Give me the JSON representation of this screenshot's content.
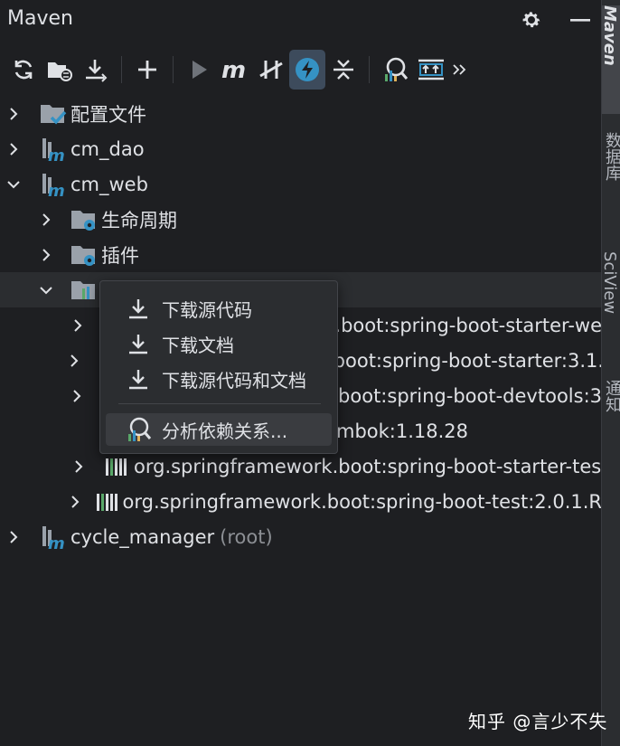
{
  "window": {
    "title": "Maven"
  },
  "title_actions": [
    {
      "name": "settings-gear-icon"
    },
    {
      "name": "minimize-icon"
    }
  ],
  "toolbar": {
    "buttons": [
      "reload-icon",
      "generate-sources-icon",
      "download-icon",
      "add-icon",
      "run-icon",
      "execute-maven-goal-icon",
      "toggle-offline-icon",
      "skip-tests-icon",
      "collapse-all-icon",
      "analyze-dependencies-icon",
      "show-dependencies-icon",
      "more-icon"
    ]
  },
  "tree": {
    "rows": [
      {
        "label": "配置文件"
      },
      {
        "label": "cm_dao"
      },
      {
        "label": "cm_web"
      },
      {
        "label": "生命周期"
      },
      {
        "label": "插件"
      },
      {
        "label": ""
      },
      {
        "label": ".boot:spring-boot-starter-we"
      },
      {
        "label": ".boot:spring-boot-starter:3.1."
      },
      {
        "label": ".boot:spring-boot-devtools:3"
      },
      {
        "label": "mbok:1.18.28"
      },
      {
        "label": "org.springframework.boot:spring-boot-starter-tes"
      },
      {
        "label": "org.springframework.boot:spring-boot-test:2.0.1.R"
      },
      {
        "label": "cycle_manager",
        "suffix": "(root)"
      }
    ]
  },
  "context_menu": {
    "items": [
      {
        "label": "下载源代码"
      },
      {
        "label": "下载文档"
      },
      {
        "label": "下载源代码和文档"
      },
      {
        "label": "分析依赖关系..."
      }
    ]
  },
  "right_strip": {
    "tabs": [
      {
        "label": "Maven",
        "active": true
      },
      {
        "label": "数据库"
      },
      {
        "label": "SciView"
      },
      {
        "label": "通知"
      }
    ]
  },
  "watermark": "知乎 @言少不失",
  "colors": {
    "background": "#1e1f22",
    "accent_blue": "#3592c4",
    "selected_row": "#2b2d30",
    "active_button": "#3d4b5c"
  }
}
